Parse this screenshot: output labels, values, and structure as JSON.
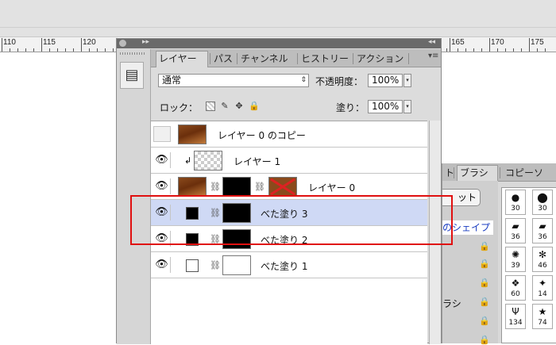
{
  "ruler": {
    "left_ticks": [
      "110",
      "115",
      "120"
    ],
    "right_ticks": [
      "165",
      "170",
      "175"
    ]
  },
  "panel": {
    "tabs": [
      "レイヤー",
      "パス",
      "チャンネル",
      "ヒストリー",
      "アクション"
    ],
    "blend_mode": "通常",
    "opacity_label": "不透明度：",
    "opacity_value": "100%",
    "lock_label": "ロック：",
    "fill_label": "塗り：",
    "fill_value": "100%",
    "menu_icon": "panel-menu-icon"
  },
  "layers": [
    {
      "name": "レイヤー 0 のコピー",
      "visible": false,
      "selected": false
    },
    {
      "name": "レイヤー 1",
      "visible": true,
      "selected": false
    },
    {
      "name": "レイヤー 0",
      "visible": true,
      "selected": false
    },
    {
      "name": "べた塗り 3",
      "visible": true,
      "selected": true
    },
    {
      "name": "べた塗り 2",
      "visible": true,
      "selected": false
    },
    {
      "name": "べた塗り 1",
      "visible": true,
      "selected": false
    }
  ],
  "background_panel": {
    "tab_brush": "ブラシ",
    "tab_copy": "コピーソ",
    "partial_button": "ット",
    "partial_shape": "のシェイプ",
    "partial_label": "ラシ",
    "brush_sizes": [
      "30",
      "30",
      "36",
      "36",
      "39",
      "46",
      "60",
      "14",
      "134",
      "74"
    ]
  },
  "colors": {
    "selection_highlight": "#cfd9f5",
    "annotation_red": "#e01010",
    "panel_bg": "#dcdcdc"
  }
}
